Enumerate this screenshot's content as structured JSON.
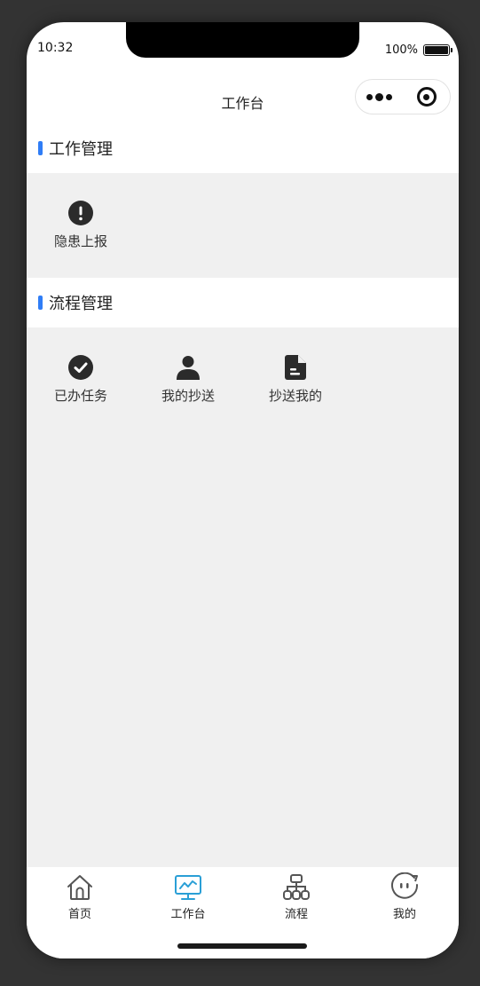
{
  "status": {
    "time": "10:32",
    "battery": "100%",
    "battery_level": 1.0
  },
  "nav": {
    "title": "工作台"
  },
  "sections": [
    {
      "title": "工作管理",
      "items": [
        {
          "label": "隐患上报",
          "icon": "exclamation-circle-icon"
        }
      ]
    },
    {
      "title": "流程管理",
      "items": [
        {
          "label": "已办任务",
          "icon": "check-circle-icon"
        },
        {
          "label": "我的抄送",
          "icon": "user-icon"
        },
        {
          "label": "抄送我的",
          "icon": "file-icon"
        }
      ]
    }
  ],
  "tabs": [
    {
      "label": "首页",
      "icon": "home-icon"
    },
    {
      "label": "工作台",
      "icon": "monitor-chart-icon",
      "active": true
    },
    {
      "label": "流程",
      "icon": "org-chart-icon"
    },
    {
      "label": "我的",
      "icon": "face-icon"
    }
  ],
  "colors": {
    "accent": "#2f7df6",
    "tab_active": "#2a9fd6",
    "icon_dark": "#2b2b2b",
    "section_bg": "#f0f0f0"
  }
}
